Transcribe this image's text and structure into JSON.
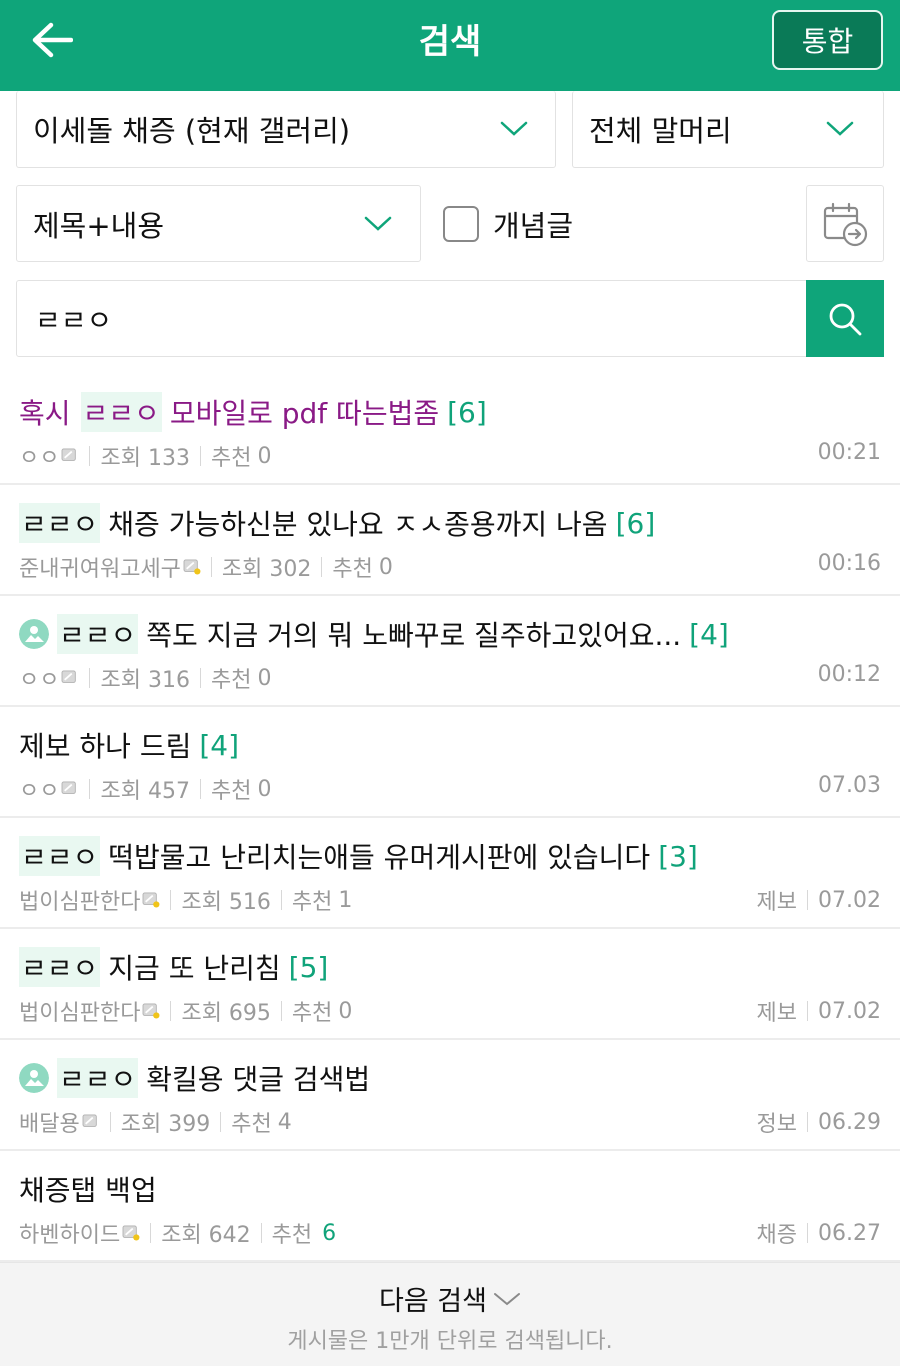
{
  "header": {
    "title": "검색",
    "integrated_label": "통합"
  },
  "filters": {
    "gallery": "이세돌 채증 (현재 갤러리)",
    "head": "전체 말머리",
    "scope": "제목+내용",
    "concept_label": "개념글",
    "concept_checked": false
  },
  "search": {
    "query": "ㄹㄹㅇ"
  },
  "results": [
    {
      "prefix": "혹시",
      "highlight": "ㄹㄹㅇ",
      "title": "모바일로 pdf 따는법좀",
      "comments": "[6]",
      "visited": true,
      "author": "ㅇㅇ",
      "views": "조회 133",
      "recommend_label": "추천",
      "recommend": "0",
      "tag": "",
      "time": "00:21",
      "has_image": false
    },
    {
      "prefix": "",
      "highlight": "ㄹㄹㅇ",
      "title": "채증 가능하신분 있나요 ㅈㅅ종용까지 나옴",
      "comments": "[6]",
      "visited": false,
      "author": "준내귀여워고세구",
      "views": "조회 302",
      "recommend_label": "추천",
      "recommend": "0",
      "tag": "",
      "time": "00:16",
      "has_image": false
    },
    {
      "prefix": "",
      "highlight": "ㄹㄹㅇ",
      "title": "쪽도 지금 거의 뭐 노빠꾸로 질주하고있어요...",
      "comments": "[4]",
      "visited": false,
      "author": "ㅇㅇ",
      "views": "조회 316",
      "recommend_label": "추천",
      "recommend": "0",
      "tag": "",
      "time": "00:12",
      "has_image": true
    },
    {
      "prefix": "",
      "highlight": "",
      "title": "제보 하나 드림",
      "comments": "[4]",
      "visited": false,
      "author": "ㅇㅇ",
      "views": "조회 457",
      "recommend_label": "추천",
      "recommend": "0",
      "tag": "",
      "time": "07.03",
      "has_image": false
    },
    {
      "prefix": "",
      "highlight": "ㄹㄹㅇ",
      "title": "떡밥물고 난리치는애들 유머게시판에 있습니다",
      "comments": "[3]",
      "visited": false,
      "author": "법이심판한다",
      "views": "조회 516",
      "recommend_label": "추천",
      "recommend": "1",
      "tag": "제보",
      "time": "07.02",
      "has_image": false
    },
    {
      "prefix": "",
      "highlight": "ㄹㄹㅇ",
      "title": "지금 또 난리침",
      "comments": "[5]",
      "visited": false,
      "author": "법이심판한다",
      "views": "조회 695",
      "recommend_label": "추천",
      "recommend": "0",
      "tag": "제보",
      "time": "07.02",
      "has_image": false
    },
    {
      "prefix": "",
      "highlight": "ㄹㄹㅇ",
      "title": "확킬용 댓글 검색법",
      "comments": "",
      "visited": false,
      "author": "배달용",
      "views": "조회 399",
      "recommend_label": "추천",
      "recommend": "4",
      "tag": "정보",
      "time": "06.29",
      "has_image": true
    },
    {
      "prefix": "",
      "highlight": "",
      "title": "채증탭 백업",
      "comments": "",
      "visited": false,
      "author": "하벤하이드",
      "views": "조회 642",
      "recommend_label": "추천",
      "recommend": "6",
      "tag": "채증",
      "time": "06.27",
      "has_image": false,
      "recommend_green": true
    }
  ],
  "footer": {
    "next_label": "다음 검색",
    "note": "게시물은 1만개 단위로 검색됩니다."
  },
  "colors": {
    "brand": "#0fa57a",
    "visited": "#8a1a86",
    "comment": "#10a37a"
  },
  "icons": {
    "back": "back-arrow-icon",
    "calendar": "calendar-icon",
    "search": "search-icon",
    "chevron": "chevron-down-icon"
  }
}
